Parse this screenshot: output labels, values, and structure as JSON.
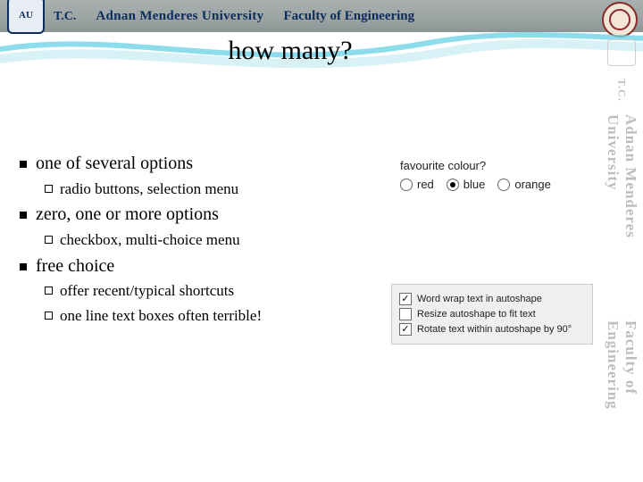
{
  "banner": {
    "tc": "T.C.",
    "university": "Adnan Menderes University",
    "faculty": "Faculty of Engineering"
  },
  "title": "how many?",
  "bullets": [
    {
      "text": "one of several options",
      "sub": [
        "radio buttons, selection menu"
      ]
    },
    {
      "text": "zero, one or more options",
      "sub": [
        "checkbox, multi-choice menu"
      ]
    },
    {
      "text": "free choice",
      "sub": [
        "offer recent/typical shortcuts",
        "one line text boxes often terrible!"
      ]
    }
  ],
  "example_radio": {
    "question": "favourite colour?",
    "options": [
      {
        "label": "red",
        "selected": false
      },
      {
        "label": "blue",
        "selected": true
      },
      {
        "label": "orange",
        "selected": false
      }
    ]
  },
  "example_checkbox": {
    "items": [
      {
        "label": "Word wrap text in autoshape",
        "checked": true
      },
      {
        "label": "Resize autoshape to fit text",
        "checked": false
      },
      {
        "label": "Rotate text within autoshape by 90°",
        "checked": true
      }
    ]
  },
  "watermark": {
    "tc": "T.C.",
    "university": "Adnan Menderes University",
    "faculty": "Faculty of Engineering"
  }
}
